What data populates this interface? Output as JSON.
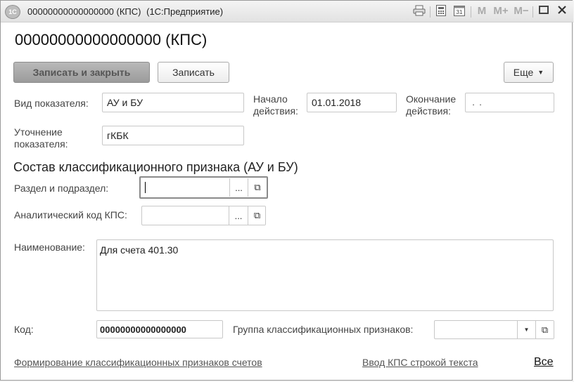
{
  "window": {
    "title": "00000000000000000 (КПС)",
    "app_name": "(1С:Предприятие)",
    "logo": "1С",
    "mem_buttons": [
      "M",
      "M+",
      "M−"
    ]
  },
  "header": {
    "title": "00000000000000000 (КПС)"
  },
  "toolbar": {
    "save_close_label": "Записать и закрыть",
    "save_label": "Записать",
    "more_label": "Еще"
  },
  "form": {
    "kind_label": "Вид показателя:",
    "kind_value": "АУ и БУ",
    "start_label_1": "Начало",
    "start_label_2": "действия:",
    "start_value": "01.01.2018",
    "end_label_1": "Окончание",
    "end_label_2": "действия:",
    "end_value": " .  .",
    "clarif_label_1": "Уточнение",
    "clarif_label_2": "показателя:",
    "clarif_value": "гКБК",
    "section_title": "Состав классификационного признака (АУ и БУ)",
    "section_label": "Раздел и подраздел:",
    "section_value": "",
    "analytic_label": "Аналитический код КПС:",
    "analytic_value": "",
    "name_label": "Наименование:",
    "name_value": "Для счета 401.30",
    "code_label": "Код:",
    "code_value": "00000000000000000",
    "group_label": "Группа классификационных признаков:",
    "group_value": "",
    "select_btn": "...",
    "open_btn": "⧉"
  },
  "footer": {
    "link_form": "Формирование классификационных признаков счетов",
    "link_input": "Ввод КПС строкой текста",
    "link_all": "Все"
  },
  "icons": {
    "print": "print-icon",
    "calc": "calculator-icon",
    "calendar": "calendar-icon",
    "maximize": "maximize-icon",
    "close": "close-icon"
  }
}
